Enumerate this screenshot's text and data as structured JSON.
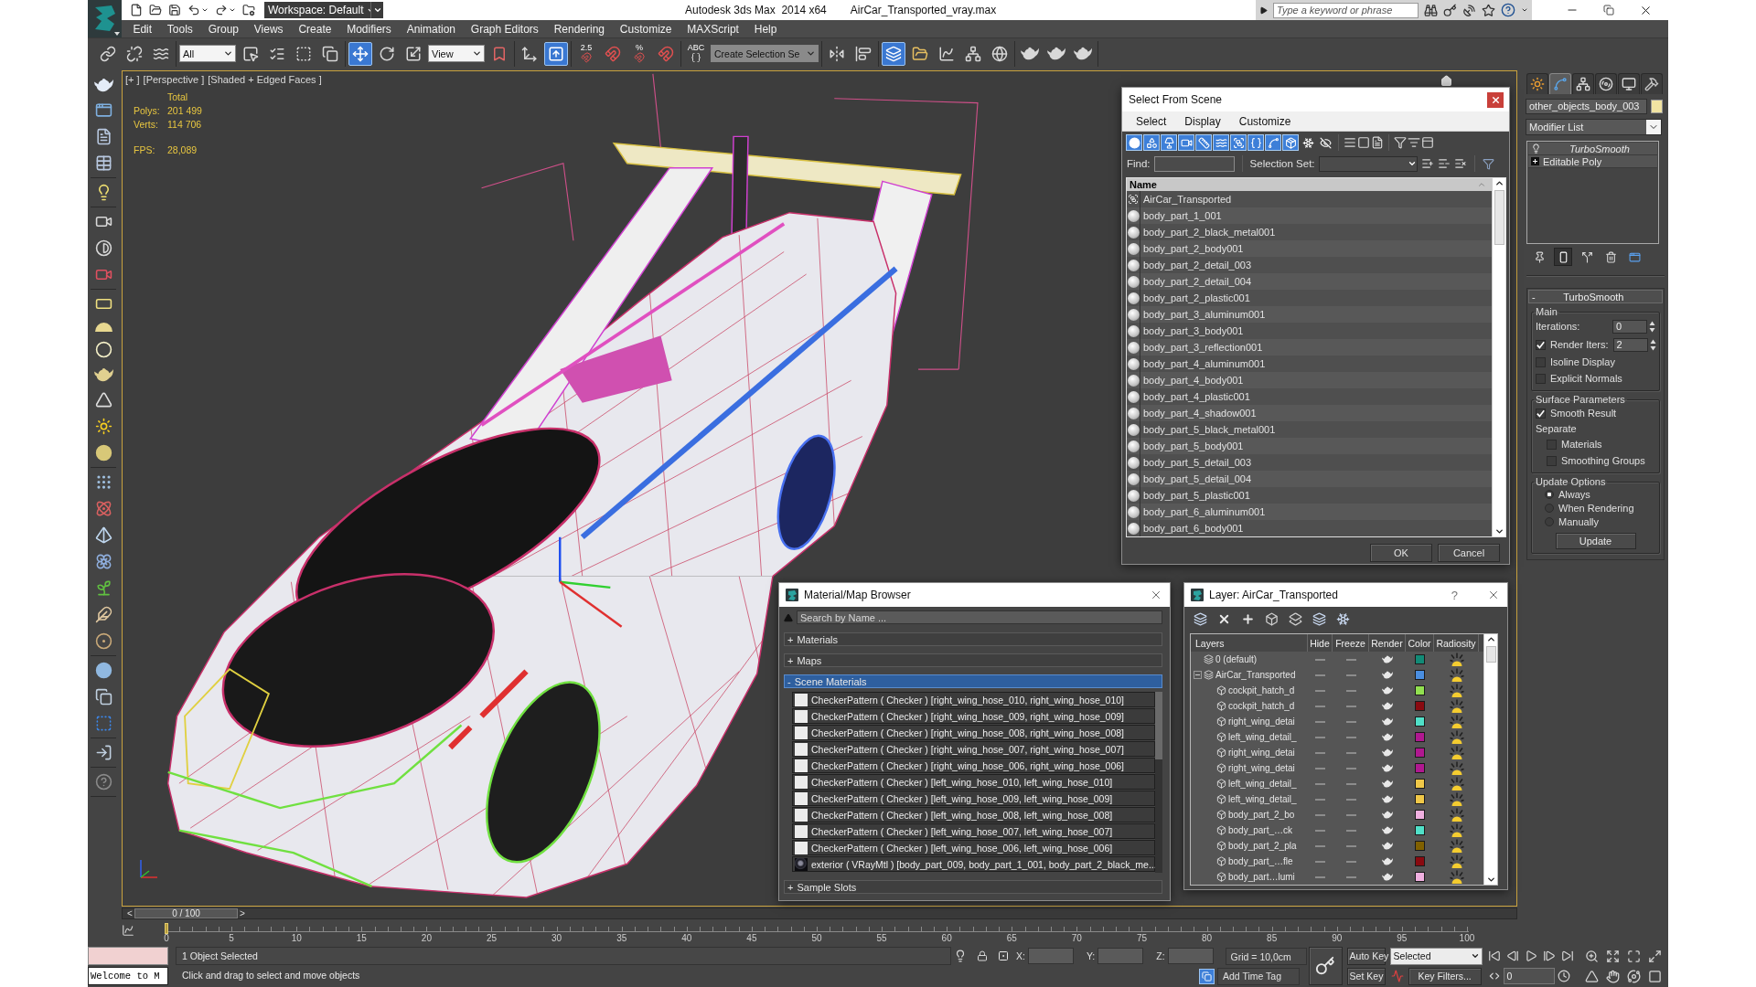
{
  "title_bar": {
    "workspace": "Workspace: Default",
    "app_title": "Autodesk 3ds Max  2014 x64",
    "file_name": "AirCar_Transported_vray.max",
    "search": {
      "placeholder": "Type a keyword or phrase"
    }
  },
  "menu": [
    "Edit",
    "Tools",
    "Group",
    "Views",
    "Create",
    "Modifiers",
    "Animation",
    "Graph Editors",
    "Rendering",
    "Customize",
    "MAXScript",
    "Help"
  ],
  "toolbar": [
    [
      {
        "kind": "link",
        "selected": false
      },
      {
        "kind": "unlink",
        "selected": false
      },
      {
        "kind": "bind",
        "selected": false
      }
    ],
    [
      {
        "kind": "dropdown",
        "value": "All"
      },
      {
        "kind": "select",
        "selected": false
      },
      {
        "kind": "select-by-name",
        "selected": false
      },
      {
        "kind": "rect-region",
        "selected": false
      },
      {
        "kind": "window-crossing",
        "selected": false
      }
    ],
    [
      {
        "kind": "move",
        "selected": true
      },
      {
        "kind": "rotate",
        "selected": false
      },
      {
        "kind": "scale",
        "selected": false
      },
      {
        "kind": "dropdown",
        "value": "View"
      },
      {
        "kind": "pivot",
        "selected": false
      }
    ],
    [
      {
        "kind": "manipulate",
        "selected": false
      },
      {
        "kind": "keyboard-override",
        "selected": true
      }
    ],
    [
      {
        "kind": "snap",
        "label": "2.5",
        "selected": false
      },
      {
        "kind": "angle-snap",
        "selected": false
      },
      {
        "kind": "percent-snap",
        "label": "%",
        "selected": false
      },
      {
        "kind": "spinner-snap",
        "selected": false
      }
    ],
    [
      {
        "kind": "named-sets",
        "label": "ABC",
        "selected": false
      },
      {
        "kind": "combo",
        "value": "Create Selection Se"
      }
    ],
    [
      {
        "kind": "mirror",
        "selected": false
      },
      {
        "kind": "align",
        "selected": false
      }
    ],
    [
      {
        "kind": "scene-explorer",
        "selected": true
      },
      {
        "kind": "layer-manager",
        "selected": false
      },
      {
        "kind": "curve-editor",
        "selected": false
      },
      {
        "kind": "schematic",
        "selected": false
      },
      {
        "kind": "material-editor",
        "selected": false
      }
    ],
    [
      {
        "kind": "render-setup",
        "selected": false
      },
      {
        "kind": "render-frame",
        "selected": false
      },
      {
        "kind": "render",
        "selected": false
      }
    ]
  ],
  "viewport": {
    "labels": [
      "[+ ]",
      "[Perspective ]",
      "[Shaded + Edged Faces ]"
    ],
    "stats_heading": "Total",
    "stats": [
      {
        "kind": "count",
        "label": "Polys:",
        "value": "201 499"
      },
      {
        "kind": "count",
        "label": "Verts:",
        "value": "114 706"
      },
      {
        "kind": "rate",
        "label": "FPS:",
        "value": "28,089"
      }
    ]
  },
  "select_from_scene": {
    "title": "Select From Scene",
    "menus": [
      "Select",
      "Display",
      "Customize"
    ],
    "filters": [
      {
        "kind": "geometry",
        "selected": true
      },
      {
        "kind": "shapes",
        "selected": true
      },
      {
        "kind": "lights",
        "selected": true
      },
      {
        "kind": "cameras",
        "selected": true
      },
      {
        "kind": "helpers",
        "selected": true
      },
      {
        "kind": "spacewarps",
        "selected": true
      },
      {
        "kind": "groups",
        "selected": true
      },
      {
        "kind": "xrefs",
        "selected": true
      },
      {
        "kind": "bones",
        "selected": true
      },
      {
        "kind": "containers",
        "selected": true
      },
      {
        "kind": "frozen",
        "selected": false
      },
      {
        "kind": "hidden",
        "selected": false
      }
    ],
    "find_label": "Find:",
    "selection_set_label": "Selection Set:",
    "column": "Name",
    "rows": [
      {
        "kind": "group",
        "name": "AirCar_Transported",
        "selected": false
      },
      {
        "kind": "object",
        "name": "body_part_1_001",
        "selected": false
      },
      {
        "kind": "object",
        "name": "body_part_2_black_metal001",
        "selected": false
      },
      {
        "kind": "object",
        "name": "body_part_2_body001",
        "selected": false
      },
      {
        "kind": "object",
        "name": "body_part_2_detail_003",
        "selected": false
      },
      {
        "kind": "object",
        "name": "body_part_2_detail_004",
        "selected": false
      },
      {
        "kind": "object",
        "name": "body_part_2_plastic001",
        "selected": false
      },
      {
        "kind": "object",
        "name": "body_part_3_aluminum001",
        "selected": false
      },
      {
        "kind": "object",
        "name": "body_part_3_body001",
        "selected": false
      },
      {
        "kind": "object",
        "name": "body_part_3_reflection001",
        "selected": false
      },
      {
        "kind": "object",
        "name": "body_part_4_aluminum001",
        "selected": false
      },
      {
        "kind": "object",
        "name": "body_part_4_body001",
        "selected": false
      },
      {
        "kind": "object",
        "name": "body_part_4_plastic001",
        "selected": false
      },
      {
        "kind": "object",
        "name": "body_part_4_shadow001",
        "selected": false
      },
      {
        "kind": "object",
        "name": "body_part_5_black_metal001",
        "selected": false
      },
      {
        "kind": "object",
        "name": "body_part_5_body001",
        "selected": false
      },
      {
        "kind": "object",
        "name": "body_part_5_detail_003",
        "selected": false
      },
      {
        "kind": "object",
        "name": "body_part_5_detail_004",
        "selected": false
      },
      {
        "kind": "object",
        "name": "body_part_5_plastic001",
        "selected": false
      },
      {
        "kind": "object",
        "name": "body_part_6_aluminum001",
        "selected": false
      },
      {
        "kind": "object",
        "name": "body_part_6_body001",
        "selected": false
      }
    ],
    "buttons": [
      "OK",
      "Cancel"
    ]
  },
  "material_browser": {
    "title": "Material/Map Browser",
    "search": {
      "placeholder": "Search by Name ..."
    },
    "sections": [
      {
        "toggle": "+",
        "label": "Materials",
        "selected": false
      },
      {
        "toggle": "+",
        "label": "Maps",
        "selected": false
      },
      {
        "toggle": "-",
        "label": "Scene Materials",
        "selected": true,
        "items": [
          {
            "kind": "checker",
            "text": "CheckerPattern ( Checker ) [right_wing_hose_010, right_wing_hose_010]"
          },
          {
            "kind": "checker",
            "text": "CheckerPattern ( Checker ) [right_wing_hose_009, right_wing_hose_009]"
          },
          {
            "kind": "checker",
            "text": "CheckerPattern ( Checker ) [right_wing_hose_008, right_wing_hose_008]"
          },
          {
            "kind": "checker",
            "text": "CheckerPattern ( Checker ) [right_wing_hose_007, right_wing_hose_007]"
          },
          {
            "kind": "checker",
            "text": "CheckerPattern ( Checker ) [right_wing_hose_006, right_wing_hose_006]"
          },
          {
            "kind": "checker",
            "text": "CheckerPattern ( Checker ) [left_wing_hose_010, left_wing_hose_010]"
          },
          {
            "kind": "checker",
            "text": "CheckerPattern ( Checker ) [left_wing_hose_009, left_wing_hose_009]"
          },
          {
            "kind": "checker",
            "text": "CheckerPattern ( Checker ) [left_wing_hose_008, left_wing_hose_008]"
          },
          {
            "kind": "checker",
            "text": "CheckerPattern ( Checker ) [left_wing_hose_007, left_wing_hose_007]"
          },
          {
            "kind": "checker",
            "text": "CheckerPattern ( Checker ) [left_wing_hose_006, left_wing_hose_006]"
          },
          {
            "kind": "vray",
            "text": "exterior ( VRayMtl ) [body_part_009, body_part_1_001, body_part_2_black_me..."
          }
        ]
      },
      {
        "toggle": "+",
        "label": "Sample Slots",
        "selected": false
      }
    ]
  },
  "layer_dialog": {
    "title": "Layer: AirCar_Transported",
    "help": "?",
    "columns": [
      "Layers",
      "Hide",
      "Freeze",
      "Render",
      "Color",
      "Radiosity"
    ],
    "layers": [
      {
        "name": "0 (default)",
        "hide": false,
        "freeze": false,
        "render": true,
        "radiosity": true,
        "color": "#128a76"
      },
      {
        "name": "AirCar_Transported",
        "expanded": true,
        "hide": false,
        "freeze": false,
        "render": true,
        "radiosity": true,
        "color": "#4a8ee0",
        "children": [
          {
            "name": "cockpit_hatch_d",
            "hide": false,
            "freeze": false,
            "render": true,
            "radiosity": true,
            "color": "#92e050"
          },
          {
            "name": "cockpit_hatch_d",
            "hide": false,
            "freeze": false,
            "render": true,
            "radiosity": true,
            "color": "#8a0a10"
          },
          {
            "name": "right_wing_detai",
            "hide": false,
            "freeze": false,
            "render": true,
            "radiosity": true,
            "color": "#50e0c8"
          },
          {
            "name": "left_wing_detail_",
            "hide": false,
            "freeze": false,
            "render": true,
            "radiosity": true,
            "color": "#b01890"
          },
          {
            "name": "right_wing_detai",
            "hide": false,
            "freeze": false,
            "render": true,
            "radiosity": true,
            "color": "#b01890"
          },
          {
            "name": "right_wing_detai",
            "hide": false,
            "freeze": false,
            "render": true,
            "radiosity": true,
            "color": "#b01890"
          },
          {
            "name": "left_wing_detail_",
            "hide": false,
            "freeze": false,
            "render": true,
            "radiosity": true,
            "color": "#f0c848"
          },
          {
            "name": "left_wing_detail_",
            "hide": false,
            "freeze": false,
            "render": true,
            "radiosity": true,
            "color": "#f0c848"
          },
          {
            "name": "body_part_2_bo",
            "hide": false,
            "freeze": false,
            "render": true,
            "radiosity": true,
            "color": "#f0b0e0"
          },
          {
            "name": "body_part_…ck",
            "hide": false,
            "freeze": false,
            "render": true,
            "radiosity": true,
            "color": "#50e0c8"
          },
          {
            "name": "body_part_2_pla",
            "hide": false,
            "freeze": false,
            "render": true,
            "radiosity": true,
            "color": "#806000"
          },
          {
            "name": "body_part_…fle",
            "hide": false,
            "freeze": false,
            "render": true,
            "radiosity": true,
            "color": "#8a0a10"
          },
          {
            "name": "body_part…lumi",
            "hide": false,
            "freeze": false,
            "render": true,
            "radiosity": true,
            "color": "#f0b0e0"
          }
        ]
      }
    ]
  },
  "command_panel": {
    "tabs": [
      {
        "kind": "create",
        "selected": false
      },
      {
        "kind": "modify",
        "selected": true
      },
      {
        "kind": "hierarchy",
        "selected": false
      },
      {
        "kind": "motion",
        "selected": false
      },
      {
        "kind": "display",
        "selected": false
      },
      {
        "kind": "utilities",
        "selected": false
      }
    ],
    "object_name": "other_objects_body_003",
    "modifier_list": "Modifier List",
    "stack": [
      {
        "kind": "modifier",
        "name": "TurboSmooth",
        "enabled": true,
        "selected": false
      },
      {
        "kind": "base",
        "name": "Editable Poly",
        "expanded": false,
        "selected": false
      }
    ],
    "stack_tools": [
      {
        "kind": "pin",
        "selected": false
      },
      {
        "kind": "end-result",
        "selected": true
      },
      {
        "kind": "unique",
        "selected": false
      },
      {
        "kind": "remove",
        "selected": false
      },
      {
        "kind": "configure",
        "selected": false
      }
    ],
    "rollout": {
      "toggle": "-",
      "title": "TurboSmooth",
      "groups": [
        {
          "label": "Main",
          "items": [
            {
              "kind": "spinner",
              "label": "Iterations:",
              "value": "0"
            },
            {
              "kind": "check-spinner",
              "label": "Render Iters:",
              "value": "2",
              "checked": true
            },
            {
              "kind": "checkbox",
              "label": "Isoline Display",
              "checked": false
            },
            {
              "kind": "checkbox",
              "label": "Explicit Normals",
              "checked": false
            }
          ]
        },
        {
          "label": "Surface Parameters",
          "items": [
            {
              "kind": "checkbox",
              "label": "Smooth Result",
              "checked": true
            },
            {
              "kind": "label",
              "label": "Separate",
              "children": [
                {
                  "kind": "checkbox",
                  "label": "Materials",
                  "checked": false
                },
                {
                  "kind": "checkbox",
                  "label": "Smoothing Groups",
                  "checked": false
                }
              ]
            }
          ]
        },
        {
          "label": "Update Options",
          "items": [
            {
              "kind": "radio",
              "label": "Always",
              "selected": true
            },
            {
              "kind": "radio",
              "label": "When Rendering",
              "selected": false
            },
            {
              "kind": "radio",
              "label": "Manually",
              "selected": false
            },
            {
              "kind": "button",
              "label": "Update"
            }
          ]
        }
      ]
    }
  },
  "timeline": {
    "prev": "<",
    "position": "0 / 100",
    "next": ">",
    "level": 0,
    "ticks": [
      "0",
      "5",
      "10",
      "15",
      "20",
      "25",
      "30",
      "35",
      "40",
      "45",
      "50",
      "55",
      "60",
      "65",
      "70",
      "75",
      "80",
      "85",
      "90",
      "95",
      "100"
    ]
  },
  "status_bar": {
    "listener": "Welcome to M",
    "selection": "1 Object Selected",
    "prompt": "Click and drag to select and move objects",
    "coords": [
      "X:",
      "Y:",
      "Z:"
    ],
    "grid": "Grid = 10,0cm",
    "time_tag": "Add Time Tag",
    "auto_key": {
      "label": "Auto Key",
      "on": false
    },
    "key_mode": "Selected",
    "set_key": "Set Key",
    "key_filters": "Key Filters...",
    "frame": "0"
  }
}
